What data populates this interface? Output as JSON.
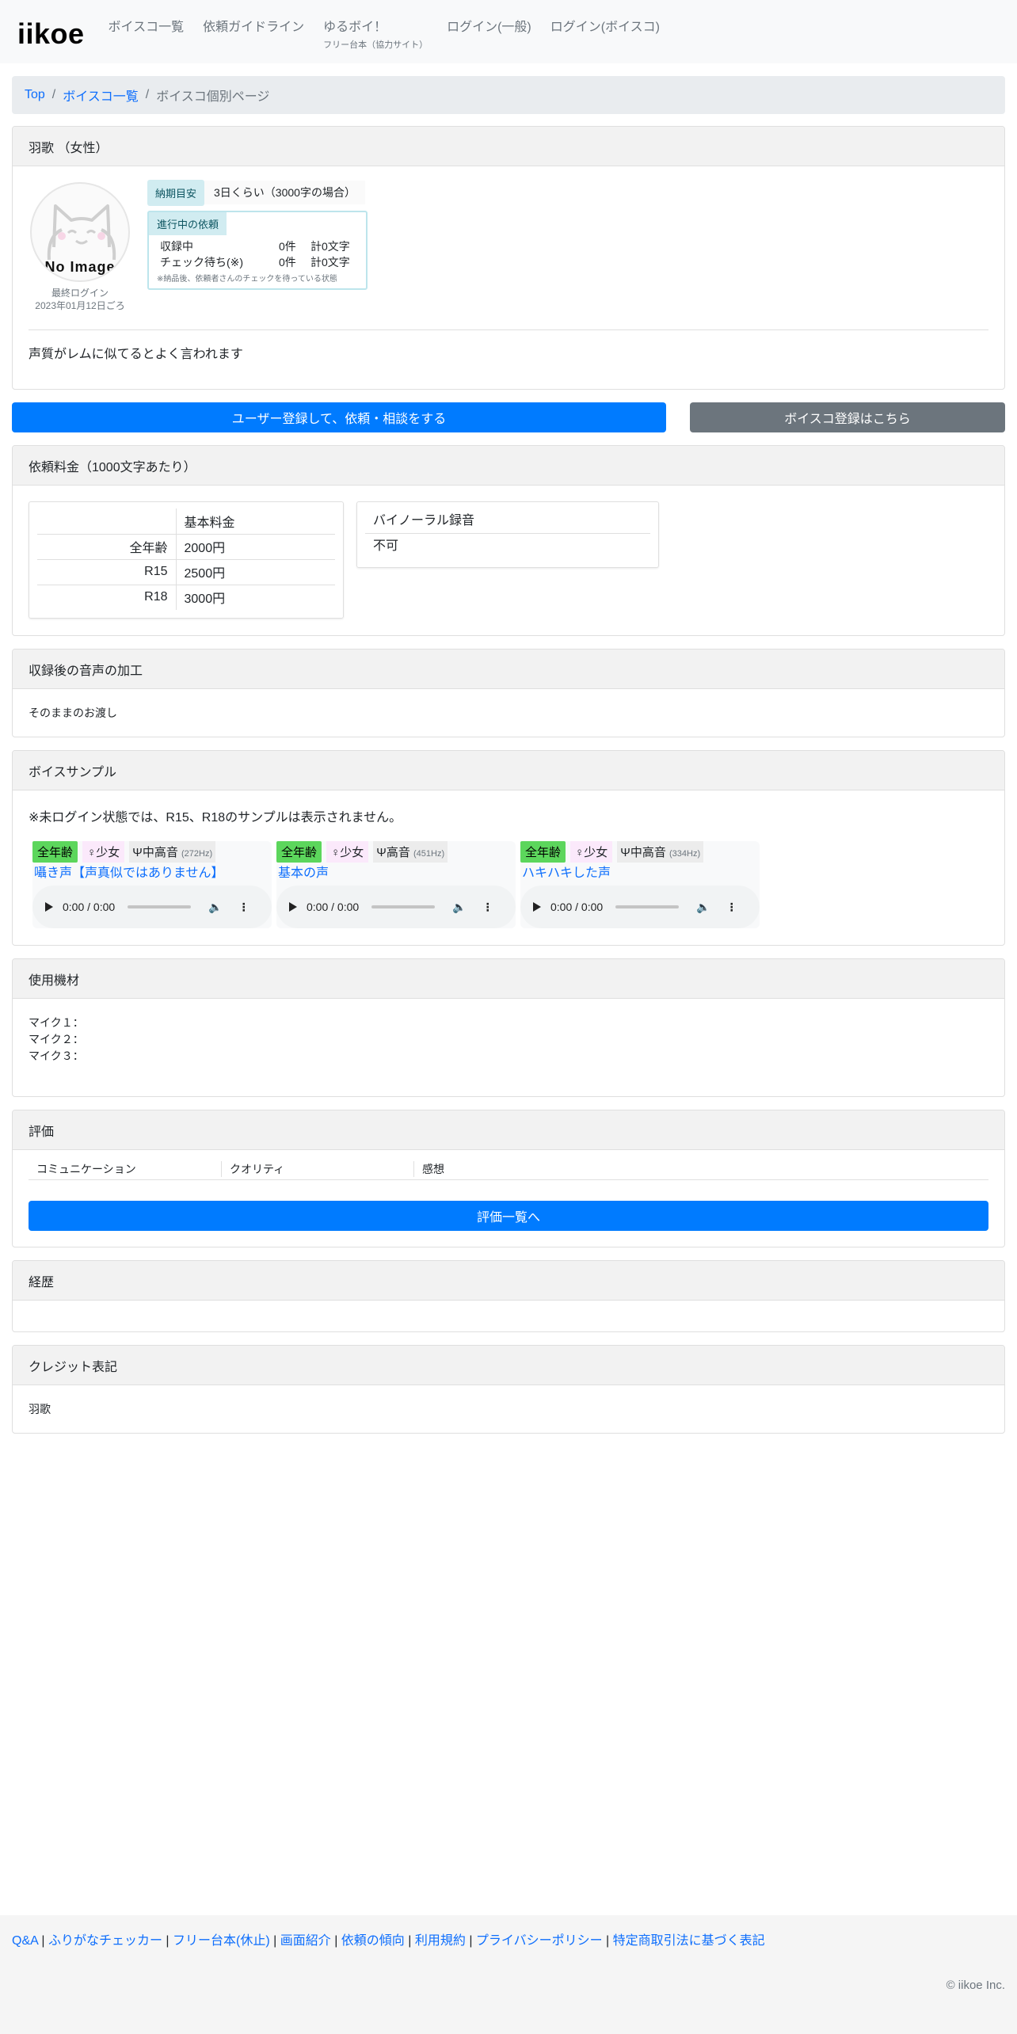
{
  "nav": {
    "brand": "iikoe",
    "links": [
      "ボイスコ一覧",
      "依頼ガイドライン"
    ],
    "yuruvoi": "ゆるボイ！",
    "yuruvoi_sub": "フリー台本（協力サイト）",
    "login_general": "ログイン(一般)",
    "login_voice": "ログイン(ボイスコ)"
  },
  "breadcrumb": {
    "top": "Top",
    "list": "ボイスコ一覧",
    "current": "ボイスコ個別ページ",
    "sep": "/"
  },
  "profile": {
    "name": "羽歌 （女性）",
    "no_image": "No Image",
    "last_login_label": "最終ログイン",
    "last_login_date": "2023年01月12日ごろ",
    "delivery_label": "納期目安",
    "delivery_value": "3日くらい（3000字の場合）",
    "progress_label": "進行中の依頼",
    "progress_rows": [
      {
        "label": "収録中",
        "count": "0件",
        "chars": "計0文字"
      },
      {
        "label": "チェック待ち(※)",
        "count": "0件",
        "chars": "計0文字"
      }
    ],
    "progress_note": "※納品後、依頼者さんのチェックを待っている状態",
    "bio": "声質がレムに似てるとよく言われます"
  },
  "buttons": {
    "register_user": "ユーザー登録して、依頼・相談をする",
    "register_voice": "ボイスコ登録はこちら"
  },
  "price": {
    "header": "依頼料金（1000文字あたり）",
    "col_header": "基本料金",
    "rows": [
      {
        "k": "全年齢",
        "v": "2000円"
      },
      {
        "k": "R15",
        "v": "2500円"
      },
      {
        "k": "R18",
        "v": "3000円"
      }
    ],
    "binaural_header": "バイノーラル録音",
    "binaural_value": "不可"
  },
  "processing": {
    "header": "収録後の音声の加工",
    "value": "そのままのお渡し"
  },
  "samples": {
    "header": "ボイスサンプル",
    "notice": "※未ログイン状態では、R15、R18のサンプルは表示されません。",
    "items": [
      {
        "age": "全年齢",
        "type": "♀少女",
        "pitch": "中高音",
        "hz": "(272Hz)",
        "title": "囁き声【声真似ではありません】",
        "time": "0:00 / 0:00"
      },
      {
        "age": "全年齢",
        "type": "♀少女",
        "pitch": "高音",
        "hz": "(451Hz)",
        "title": "基本の声",
        "time": "0:00 / 0:00"
      },
      {
        "age": "全年齢",
        "type": "♀少女",
        "pitch": "中高音",
        "hz": "(334Hz)",
        "title": "ハキハキした声",
        "time": "0:00 / 0:00"
      }
    ]
  },
  "equipment": {
    "header": "使用機材",
    "mic1": "マイク１：",
    "mic2": "マイク２：",
    "mic3": "マイク３："
  },
  "rating": {
    "header": "評価",
    "cols": [
      "コミュニケーション",
      "クオリティ",
      "感想"
    ],
    "button": "評価一覧へ"
  },
  "career": {
    "header": "経歴"
  },
  "credit": {
    "header": "クレジット表記",
    "value": "羽歌"
  },
  "footer": {
    "links": [
      "Q&A",
      "ふりがなチェッカー",
      "フリー台本(休止)",
      "画面紹介",
      "依頼の傾向",
      "利用規約",
      "プライバシーポリシー",
      "特定商取引法に基づく表記"
    ],
    "copyright": "© iikoe Inc."
  },
  "colors": {
    "primary": "#007bff",
    "secondary": "#6c757d",
    "age_badge": "#5cd65c",
    "info_badge": "#d1ecf1"
  }
}
